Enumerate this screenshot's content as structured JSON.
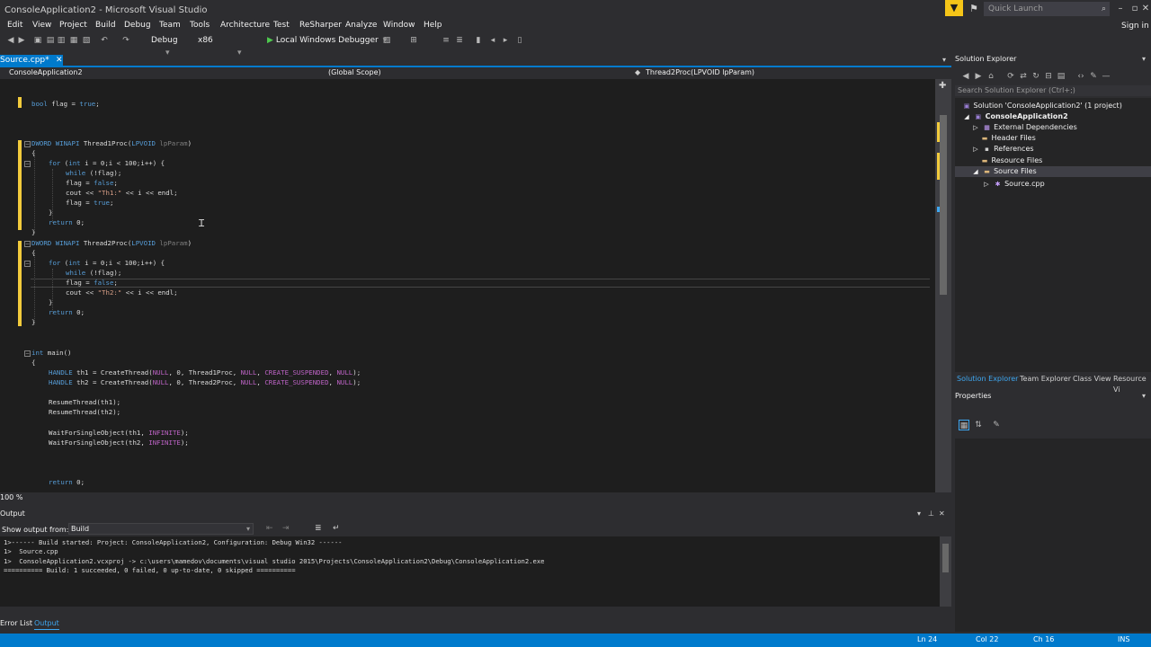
{
  "window": {
    "title": "ConsoleApplication2 - Microsoft Visual Studio",
    "quick_launch_placeholder": "Quick Launch",
    "sign_in": "Sign in"
  },
  "menu": [
    "Edit",
    "View",
    "Project",
    "Build",
    "Debug",
    "Team",
    "Tools",
    "Architecture",
    "Test",
    "ReSharper",
    "Analyze",
    "Window",
    "Help"
  ],
  "toolbar": {
    "configuration": "Debug",
    "platform": "x86",
    "run_label": "Local Windows Debugger"
  },
  "document_tab": {
    "label": "Source.cpp*"
  },
  "navbar": {
    "project": "ConsoleApplication2",
    "scope": "(Global Scope)",
    "member": "Thread2Proc(LPVOID lpParam)"
  },
  "code": {
    "lines": [
      "bool flag = true;",
      "DWORD WINAPI Thread1Proc(LPVOID lpParam)",
      "{",
      "for (int i = 0;i < 100;i++) {",
      "while (!flag);",
      "flag = false;",
      "cout << \"Th1:\" << i << endl;",
      "flag = true;",
      "}",
      "return 0;",
      "}",
      "DWORD WINAPI Thread2Proc(LPVOID lpParam)",
      "{",
      "for (int i = 0;i < 100;i++) {",
      "while (!flag);",
      "flag = false;",
      "cout << \"Th2:\" << i << endl;",
      "}",
      "return 0;",
      "}",
      "int main()",
      "{",
      "HANDLE th1 = CreateThread(NULL, 0, Thread1Proc, NULL, CREATE_SUSPENDED, NULL);",
      "HANDLE th2 = CreateThread(NULL, 0, Thread2Proc, NULL, CREATE_SUSPENDED, NULL);",
      "ResumeThread(th1);",
      "ResumeThread(th2);",
      "WaitForSingleObject(th1, INFINITE);",
      "WaitForSingleObject(th2, INFINITE);",
      "return 0;"
    ]
  },
  "editor": {
    "zoom": "100 %"
  },
  "output": {
    "title": "Output",
    "source_label": "Show output from:",
    "source_value": "Build",
    "lines": [
      "1>------ Build started: Project: ConsoleApplication2, Configuration: Debug Win32 ------",
      "1>  Source.cpp",
      "1>  ConsoleApplication2.vcxproj -> c:\\users\\mamedov\\documents\\visual studio 2015\\Projects\\ConsoleApplication2\\Debug\\ConsoleApplication2.exe",
      "========== Build: 1 succeeded, 0 failed, 0 up-to-date, 0 skipped =========="
    ]
  },
  "bottom_tabs": [
    "Error List",
    "Output"
  ],
  "solution_explorer": {
    "title": "Solution Explorer",
    "search_placeholder": "Search Solution Explorer (Ctrl+;)",
    "tree": [
      {
        "label": "Solution 'ConsoleApplication2' (1 project)",
        "depth": 0
      },
      {
        "label": "ConsoleApplication2",
        "depth": 1
      },
      {
        "label": "External Dependencies",
        "depth": 2
      },
      {
        "label": "Header Files",
        "depth": 2
      },
      {
        "label": "References",
        "depth": 2
      },
      {
        "label": "Resource Files",
        "depth": 2
      },
      {
        "label": "Source Files",
        "depth": 2
      },
      {
        "label": "Source.cpp",
        "depth": 3
      }
    ],
    "tabs": [
      "Solution Explorer",
      "Team Explorer",
      "Class View",
      "Resource Vi"
    ]
  },
  "properties": {
    "title": "Properties"
  },
  "status": {
    "line": "Ln 24",
    "col": "Col 22",
    "ch": "Ch 16",
    "mode": "INS"
  },
  "colors": {
    "accent": "#007acc",
    "change_bar": "#f2cb3c",
    "keyword": "#569cd6",
    "string": "#d69d85",
    "macro": "#bd63c5"
  }
}
